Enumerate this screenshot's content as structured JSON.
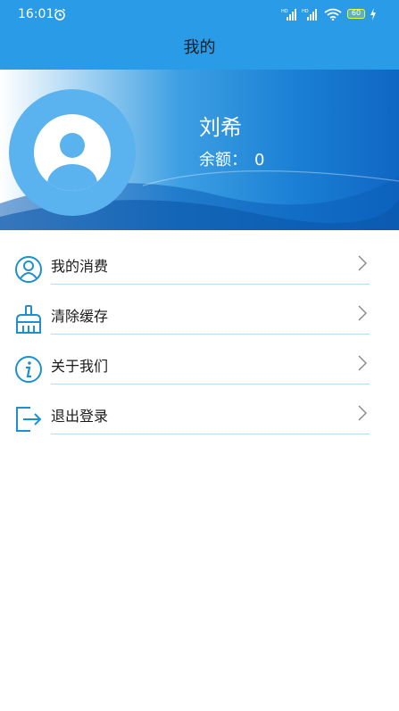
{
  "status_bar": {
    "time": "16:01",
    "battery": "60"
  },
  "app_bar": {
    "title": "我的"
  },
  "profile": {
    "name": "刘希",
    "balance_label": "余额：",
    "balance_value": "0"
  },
  "menu": {
    "items": [
      {
        "label": "我的消费",
        "icon": "user-circle-icon"
      },
      {
        "label": "清除缓存",
        "icon": "broom-icon"
      },
      {
        "label": "关于我们",
        "icon": "info-icon"
      },
      {
        "label": "退出登录",
        "icon": "logout-icon"
      }
    ]
  },
  "colors": {
    "accent": "#2a9be6",
    "icon": "#1e8fcf",
    "divider": "#b8dcef"
  }
}
